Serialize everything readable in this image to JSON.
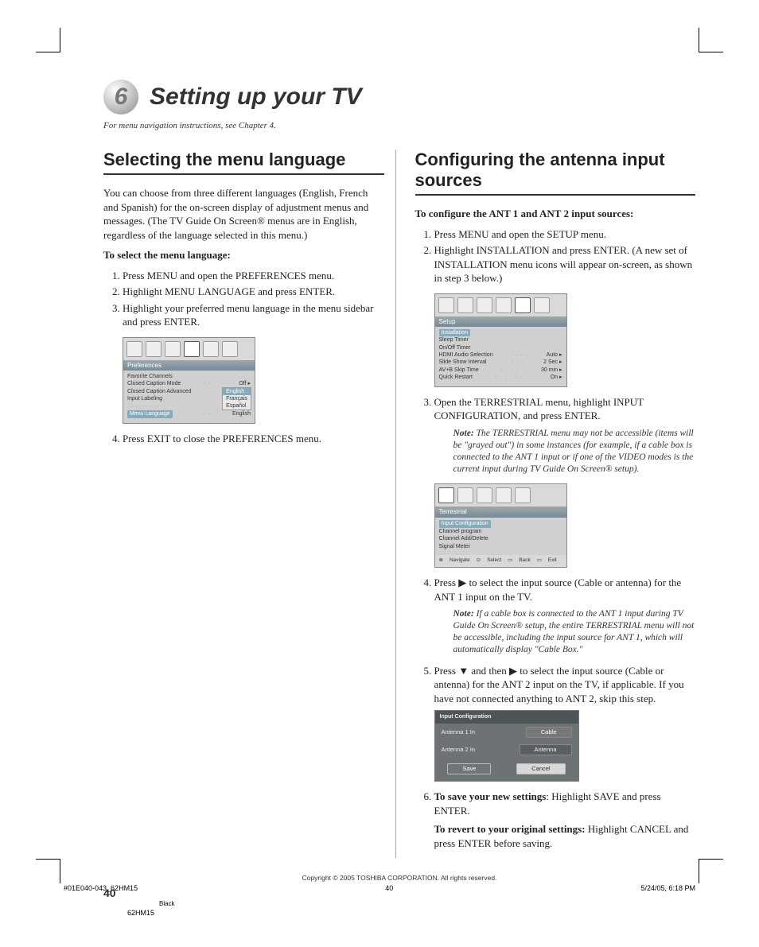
{
  "chapter": {
    "number": "6",
    "title": "Setting up your TV",
    "sub": "For menu navigation instructions, see Chapter 4."
  },
  "left": {
    "heading": "Selecting the menu language",
    "intro": "You can choose from three different languages (English, French and Spanish) for the on-screen display of adjustment menus and messages. (The TV Guide On Screen® menus are in English, regardless of the language selected in this menu.)",
    "task": "To select the menu language:",
    "steps": [
      "Press MENU and open the PREFERENCES menu.",
      "Highlight MENU LANGUAGE and press ENTER.",
      "Highlight your preferred menu language in the menu sidebar and press ENTER.",
      "Press EXIT to close the PREFERENCES menu."
    ],
    "shot": {
      "title": "Preferences",
      "rows": [
        {
          "l": "Favorite Channels",
          "r": ""
        },
        {
          "l": "Closed Caption Mode",
          "r": "Off ▸"
        },
        {
          "l": "Closed Caption Advanced",
          "r": ""
        },
        {
          "l": "Input Labeling",
          "r": ""
        },
        {
          "l": "Menu Language",
          "r": "English"
        }
      ],
      "popup": [
        "English",
        "Français",
        "Español"
      ]
    }
  },
  "right": {
    "heading": "Configuring the antenna input sources",
    "task": "To configure the ANT 1 and ANT 2 input sources:",
    "steps_12": [
      "Press MENU and open the SETUP menu.",
      "Highlight INSTALLATION and press ENTER. (A new set of INSTALLATION menu icons will appear on-screen, as shown in step 3 below.)"
    ],
    "shot_setup": {
      "title": "Setup",
      "rows": [
        {
          "l": "Installation",
          "r": ""
        },
        {
          "l": "Sleep Timer",
          "r": ""
        },
        {
          "l": "On/Off Timer",
          "r": ""
        },
        {
          "l": "HDMI Audio Selection",
          "r": "Auto ▸"
        },
        {
          "l": "Slide Show Interval",
          "r": "2 Sec ▸"
        },
        {
          "l": "AV+B Skip Time",
          "r": "30 min ▸"
        },
        {
          "l": "Quick Restart",
          "r": "On ▸"
        }
      ]
    },
    "step3": "Open the TERRESTRIAL menu, highlight INPUT CONFIGURATION, and press ENTER.",
    "note3": "The TERRESTRIAL menu may not be accessible (items will be \"grayed out\") in some instances (for example, if a cable box is connected to the ANT 1 input or if one of the VIDEO modes is the current input during TV Guide On Screen® setup).",
    "shot_terr": {
      "title": "Terrestrial",
      "rows": [
        "Input Configuration",
        "Channel program",
        "Channel Add/Delete",
        "Signal Meter"
      ],
      "footer": [
        "Navigate",
        "Select",
        "Back",
        "Exit"
      ]
    },
    "step4": "Press ▶ to select the input source (Cable or antenna) for the ANT 1 input on the TV.",
    "note4": "If a cable box is connected to the ANT 1 input during TV Guide On Screen® setup, the entire TERRESTRIAL menu will not be accessible, including the input source for ANT 1, which will automatically display \"Cable Box.\"",
    "step5": "Press ▼ and then ▶ to select the input source (Cable or antenna) for the ANT 2 input on the TV, if applicable. If you have not connected anything to ANT 2, skip this step.",
    "shot_ic": {
      "title": "Input Configuration",
      "a1": "Antenna 1 In",
      "v1": "Cable",
      "a2": "Antenna 2 In",
      "v2": "Antenna",
      "save": "Save",
      "cancel": "Cancel"
    },
    "step6a_label": "To save your new settings",
    "step6a_rest": ": Highlight SAVE and press ENTER.",
    "step6b_label": "To revert to your original settings:",
    "step6b_rest": " Highlight CANCEL and press ENTER before saving."
  },
  "note_label": "Note:",
  "footer": {
    "copy": "Copyright © 2005 TOSHIBA CORPORATION. All rights reserved.",
    "page": "40",
    "file": "#01E040-043_62HM15",
    "pg": "40",
    "date": "5/24/05, 6:18 PM",
    "model": "62HM15",
    "black": "Black"
  }
}
